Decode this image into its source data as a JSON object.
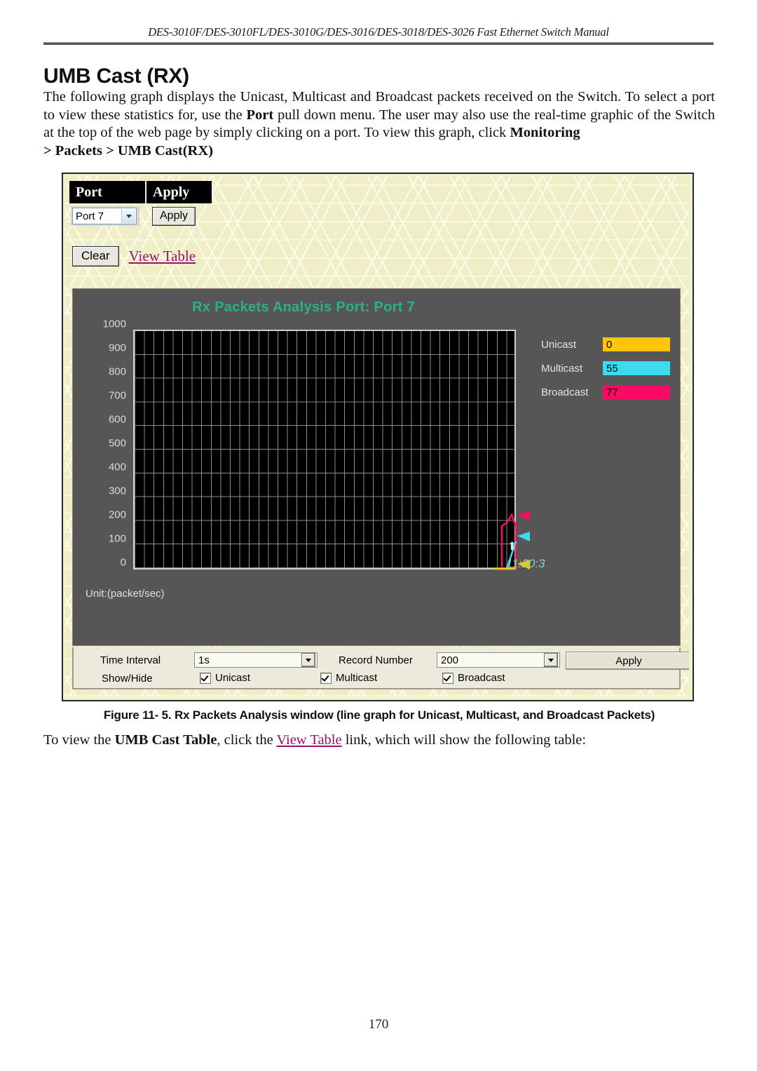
{
  "document": {
    "running_header": "DES-3010F/DES-3010FL/DES-3010G/DES-3016/DES-3018/DES-3026 Fast Ethernet Switch Manual",
    "page_title": "UMB Cast (RX)",
    "intro_line1": "The following graph displays the Unicast, Multicast and Broadcast packets received on the Switch. To select",
    "intro_line2_a": "a port to view these statistics for, use the ",
    "intro_line2_bold": "Port",
    "intro_line2_b": " pull down menu. The user may also use the real-time graphic",
    "intro_line3_a": "of the Switch at the top of the web page by simply clicking on a port. To view this graph, click ",
    "intro_line3_bold": "Monitoring",
    "intro_line4_bold": "> Packets > UMB Cast(RX)",
    "figure_caption": "Figure 11- 5. Rx Packets Analysis window (line graph for Unicast, Multicast, and Broadcast Packets)",
    "after_a": "To view the ",
    "after_bold": "UMB Cast Table",
    "after_b": ", click the ",
    "after_link": "View Table",
    "after_c": " link, which will show the following table:",
    "page_number": "170"
  },
  "screenshot": {
    "table_headers": {
      "port": "Port",
      "apply": "Apply"
    },
    "port_select": {
      "value": "Port 7",
      "icon": "chevron-down-icon"
    },
    "apply_button": "Apply",
    "clear_button": "Clear",
    "view_table_link": "View Table",
    "graph": {
      "title": "Rx Packets Analysis Port: Port 7",
      "unit_label": "Unit:(packet/sec)",
      "timestamp": "11:20:3",
      "marker_icon": "up-arrow-icon"
    },
    "legend": [
      {
        "label": "Unicast",
        "value": "0",
        "color": "#FFC40C"
      },
      {
        "label": "Multicast",
        "value": "55",
        "color": "#3BDCEE"
      },
      {
        "label": "Broadcast",
        "value": "77",
        "color": "#FA0A64"
      }
    ],
    "toolbar": {
      "time_interval_label": "Time Interval",
      "time_interval_value": "1s",
      "record_number_label": "Record Number",
      "record_number_value": "200",
      "apply_label": "Apply",
      "show_hide_label": "Show/Hide",
      "checkboxes": [
        {
          "label": "Unicast",
          "checked": true
        },
        {
          "label": "Multicast",
          "checked": true
        },
        {
          "label": "Broadcast",
          "checked": true
        }
      ]
    }
  },
  "chart_data": {
    "type": "line",
    "title": "Rx Packets Analysis Port: Port 7",
    "xlabel": "",
    "ylabel": "Unit:(packet/sec)",
    "ylim": [
      0,
      1000
    ],
    "yticks": [
      1000,
      900,
      800,
      700,
      600,
      500,
      400,
      300,
      200,
      100,
      0
    ],
    "grid": true,
    "legend_position": "right",
    "x_time_marker": "11:20:3",
    "series": [
      {
        "name": "Unicast",
        "color": "#FFC40C",
        "current": 0,
        "values": [
          0,
          0,
          0,
          0,
          0,
          0
        ]
      },
      {
        "name": "Multicast",
        "color": "#3BDCEE",
        "current": 55,
        "values": [
          0,
          0,
          0,
          0,
          30,
          55
        ]
      },
      {
        "name": "Broadcast",
        "color": "#FA0A64",
        "current": 77,
        "values": [
          0,
          0,
          0,
          130,
          95,
          77
        ]
      }
    ]
  }
}
